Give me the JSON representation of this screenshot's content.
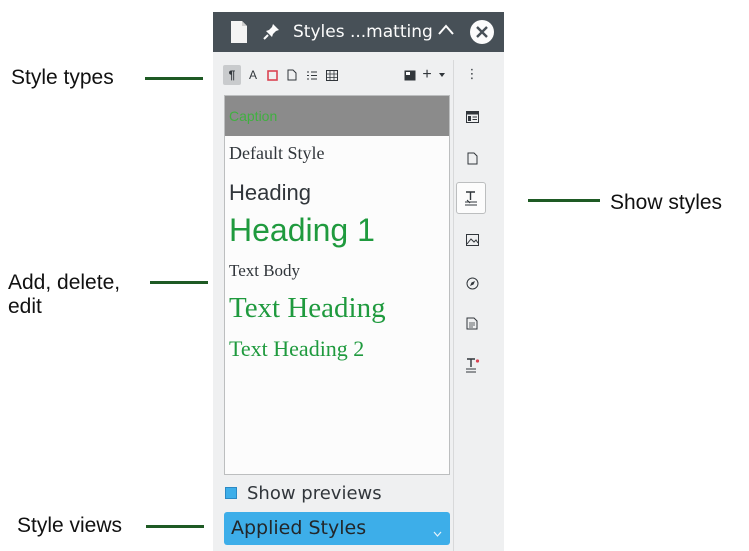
{
  "panel": {
    "title": "Styles ...matting",
    "toolbar": {
      "paragraph_icon": "¶",
      "character_icon": "A",
      "new_icon": "+"
    },
    "styles": [
      {
        "name": "Caption",
        "selected": true
      },
      {
        "name": "Default Style"
      },
      {
        "name": "Heading"
      },
      {
        "name": "Heading 1"
      },
      {
        "name": "Text Body"
      },
      {
        "name": "Text Heading"
      },
      {
        "name": "Text Heading 2"
      }
    ],
    "sidebar_menu_glyph": "⋮",
    "show_previews_label": "Show previews",
    "show_previews_checked": true,
    "filter_value": "Applied Styles"
  },
  "annotations": {
    "style_types": "Style types",
    "add_delete_edit_line1": "Add, delete,",
    "add_delete_edit_line2": "edit",
    "style_views": "Style views",
    "show_styles": "Show styles"
  },
  "colors": {
    "titlebar": "#475057",
    "accent": "#3daee9",
    "heading_green": "#1f9a3e",
    "annotation_line": "#1e5a24"
  }
}
